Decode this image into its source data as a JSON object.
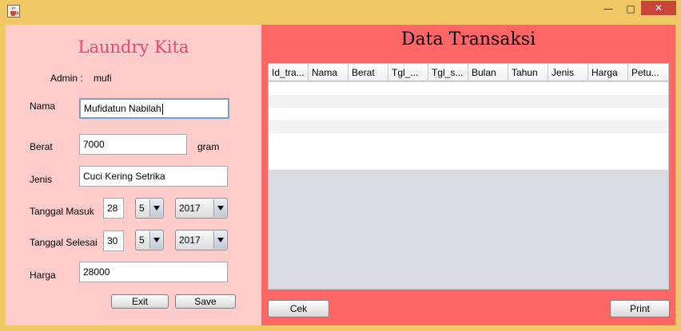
{
  "window": {
    "minimize_glyph": "—",
    "maximize_glyph": "□",
    "close_glyph": "✕",
    "icon": "java-cup-icon"
  },
  "form": {
    "app_title": "Laundry Kita",
    "admin_label": "Admin :",
    "admin_user": "mufi",
    "nama_label": "Nama",
    "nama_value": "Mufidatun Nabilah",
    "berat_label": "Berat",
    "berat_value": "7000",
    "berat_unit": "gram",
    "jenis_label": "Jenis",
    "jenis_value": "Cuci Kering Setrika",
    "masuk_label": "Tanggal Masuk",
    "masuk_day": "28",
    "masuk_month": "5",
    "masuk_year": "2017",
    "selesai_label": "Tanggal Selesai",
    "selesai_day": "30",
    "selesai_month": "5",
    "selesai_year": "2017",
    "harga_label": "Harga",
    "harga_value": "28000",
    "exit_label": "Exit",
    "save_label": "Save"
  },
  "data": {
    "title": "Data Transaksi",
    "columns": [
      "Id_tra...",
      "Nama",
      "Berat",
      "Tgl_...",
      "Tgl_s...",
      "Bulan",
      "Tahun",
      "Jenis",
      "Harga",
      "Petu..."
    ],
    "cek_label": "Cek",
    "print_label": "Print"
  },
  "colors": {
    "window_frame": "#f0c864",
    "left_panel": "#ffcccc",
    "right_panel": "#ff6666",
    "title_accent": "#e8476e"
  }
}
